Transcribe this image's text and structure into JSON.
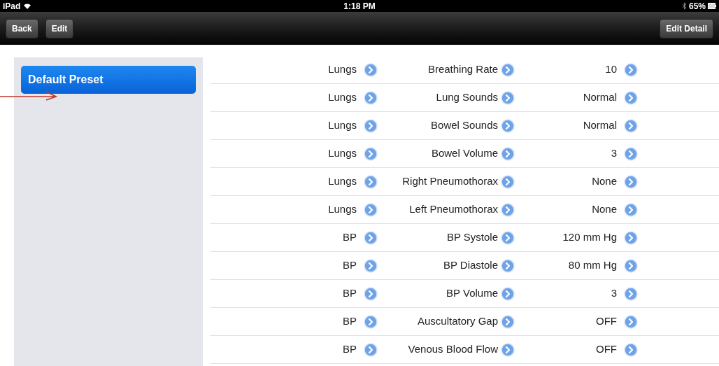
{
  "status_bar": {
    "device": "iPad",
    "time": "1:18 PM",
    "battery": "65%"
  },
  "nav_bar": {
    "left_buttons": [
      "Back",
      "Edit"
    ],
    "right_button": "Edit Detail"
  },
  "sidebar": {
    "items": [
      {
        "label": "Default Preset",
        "selected": true
      }
    ]
  },
  "rows": [
    {
      "group": "Lungs",
      "parameter": "Breathing Rate",
      "value": "10"
    },
    {
      "group": "Lungs",
      "parameter": "Lung Sounds",
      "value": "Normal"
    },
    {
      "group": "Lungs",
      "parameter": "Bowel Sounds",
      "value": "Normal"
    },
    {
      "group": "Lungs",
      "parameter": "Bowel Volume",
      "value": "3"
    },
    {
      "group": "Lungs",
      "parameter": "Right Pneumothorax",
      "value": "None"
    },
    {
      "group": "Lungs",
      "parameter": "Left Pneumothorax",
      "value": "None"
    },
    {
      "group": "BP",
      "parameter": "BP Systole",
      "value": "120 mm Hg"
    },
    {
      "group": "BP",
      "parameter": "BP Diastole",
      "value": "80 mm Hg"
    },
    {
      "group": "BP",
      "parameter": "BP Volume",
      "value": "3"
    },
    {
      "group": "BP",
      "parameter": "Auscultatory Gap",
      "value": "OFF"
    },
    {
      "group": "BP",
      "parameter": "Venous Blood Flow",
      "value": "OFF"
    }
  ]
}
